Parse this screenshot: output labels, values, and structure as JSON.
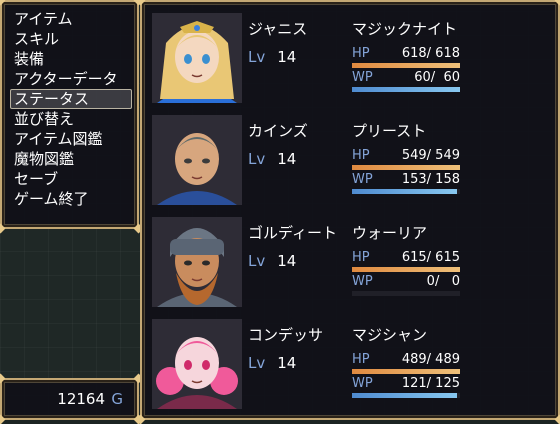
{
  "menu": {
    "items": [
      "アイテム",
      "スキル",
      "装備",
      "アクターデータ",
      "ステータス",
      "並び替え",
      "アイテム図鑑",
      "魔物図鑑",
      "セーブ",
      "ゲーム終了"
    ],
    "selected_index": 4
  },
  "gold": {
    "value": "12164",
    "unit": "G"
  },
  "labels": {
    "lv": "Lv",
    "hp": "HP",
    "wp": "WP"
  },
  "party": [
    {
      "name": "ジャニス",
      "class": "マジックナイト",
      "level": "14",
      "hp": "618",
      "hp_max": "618",
      "wp": "60",
      "wp_max": "60",
      "portrait": {
        "hair": "#e9c775",
        "skin": "#f4d8c0",
        "eye": "#3a8fd0",
        "accent": "#2a6fd8"
      }
    },
    {
      "name": "カインズ",
      "class": "プリースト",
      "level": "14",
      "hp": "549",
      "hp_max": "549",
      "wp": "153",
      "wp_max": "158",
      "portrait": {
        "hair": "#5e6a6a",
        "skin": "#d7a67e",
        "eye": "#3b3b3b",
        "accent": "#2a4f9a"
      }
    },
    {
      "name": "ゴルディート",
      "class": "ウォーリア",
      "level": "14",
      "hp": "615",
      "hp_max": "615",
      "wp": "0",
      "wp_max": "0",
      "portrait": {
        "hair": "#b5682e",
        "skin": "#c98c5e",
        "eye": "#2a2a2a",
        "accent": "#5a6574"
      }
    },
    {
      "name": "コンデッサ",
      "class": "マジシャン",
      "level": "14",
      "hp": "489",
      "hp_max": "489",
      "wp": "121",
      "wp_max": "125",
      "portrait": {
        "hair": "#f05a9a",
        "skin": "#f6d6dc",
        "eye": "#d02a6a",
        "accent": "#7a2a4a"
      }
    }
  ]
}
